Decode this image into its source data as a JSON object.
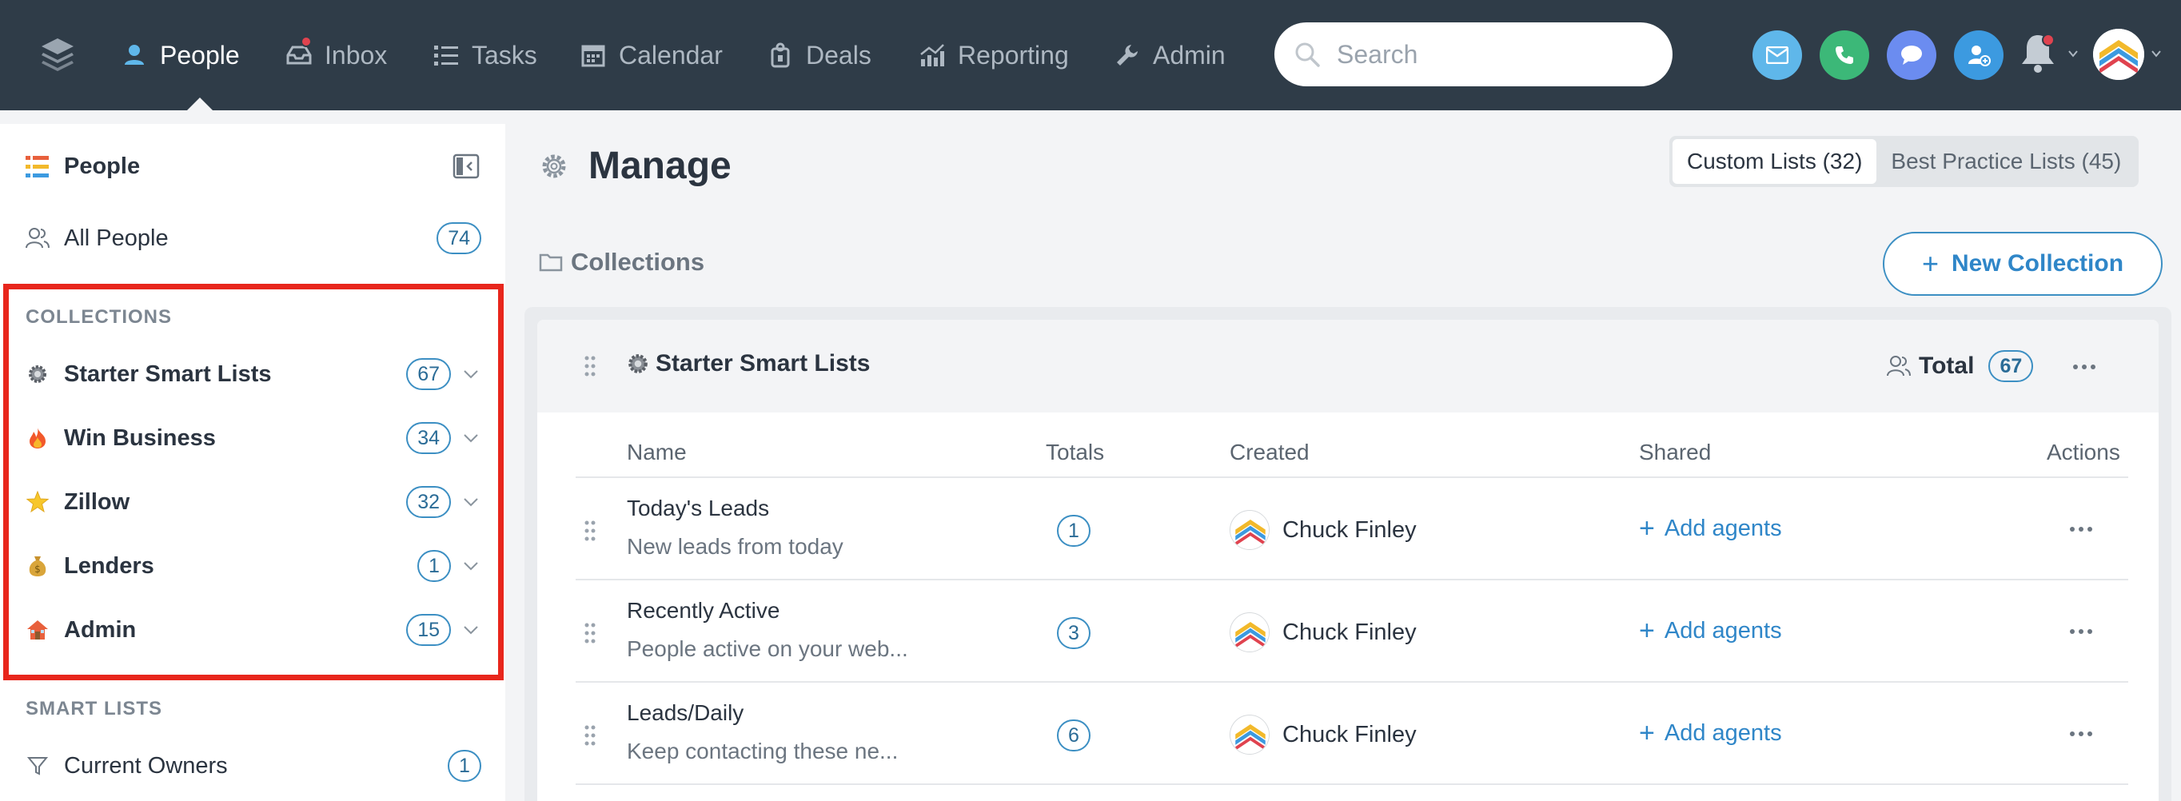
{
  "nav": {
    "items": [
      {
        "label": "People",
        "icon": "people-icon"
      },
      {
        "label": "Inbox",
        "icon": "inbox-icon"
      },
      {
        "label": "Tasks",
        "icon": "tasks-icon"
      },
      {
        "label": "Calendar",
        "icon": "calendar-icon"
      },
      {
        "label": "Deals",
        "icon": "deals-icon"
      },
      {
        "label": "Reporting",
        "icon": "reporting-icon"
      },
      {
        "label": "Admin",
        "icon": "wrench-icon"
      }
    ],
    "search_placeholder": "Search",
    "colors": {
      "bar": "#2f3c48",
      "active": "#ffffff",
      "inactive": "#aeb8c2",
      "email": "#5fb7ea",
      "phone": "#3cb878",
      "chat": "#6b8cf0",
      "add_person": "#3c9ae0"
    }
  },
  "sidebar": {
    "title": "People",
    "all_people": {
      "label": "All People",
      "count": "74"
    },
    "collections_title": "COLLECTIONS",
    "collections": [
      {
        "label": "Starter Smart Lists",
        "count": "67",
        "icon": "gear-icon"
      },
      {
        "label": "Win Business",
        "count": "34",
        "icon": "fire-icon"
      },
      {
        "label": "Zillow",
        "count": "32",
        "icon": "star-icon"
      },
      {
        "label": "Lenders",
        "count": "1",
        "icon": "money-bag-icon"
      },
      {
        "label": "Admin",
        "count": "15",
        "icon": "house-icon"
      }
    ],
    "smart_lists_title": "SMART LISTS",
    "smart_lists": [
      {
        "label": "Current Owners",
        "count": "1",
        "icon": "filter-icon"
      }
    ],
    "highlight_color": "#e8261c"
  },
  "main": {
    "title": "Manage",
    "tabs": [
      {
        "label": "Custom Lists (32)",
        "selected": true
      },
      {
        "label": "Best Practice Lists (45)",
        "selected": false
      }
    ],
    "collections_label": "Collections",
    "new_collection_label": "New Collection",
    "panel": {
      "title": "Starter Smart Lists",
      "total_label": "Total",
      "total_count": "67",
      "columns": [
        "Name",
        "Totals",
        "Created",
        "Shared",
        "Actions"
      ],
      "rows": [
        {
          "name": "Today's Leads",
          "desc": "New leads from today",
          "total": "1",
          "creator": "Chuck Finley",
          "shared": "Add agents"
        },
        {
          "name": "Recently Active",
          "desc": "People active on your web...",
          "total": "3",
          "creator": "Chuck Finley",
          "shared": "Add agents"
        },
        {
          "name": "Leads/Daily",
          "desc": "Keep contacting these ne...",
          "total": "6",
          "creator": "Chuck Finley",
          "shared": "Add agents"
        }
      ]
    }
  }
}
